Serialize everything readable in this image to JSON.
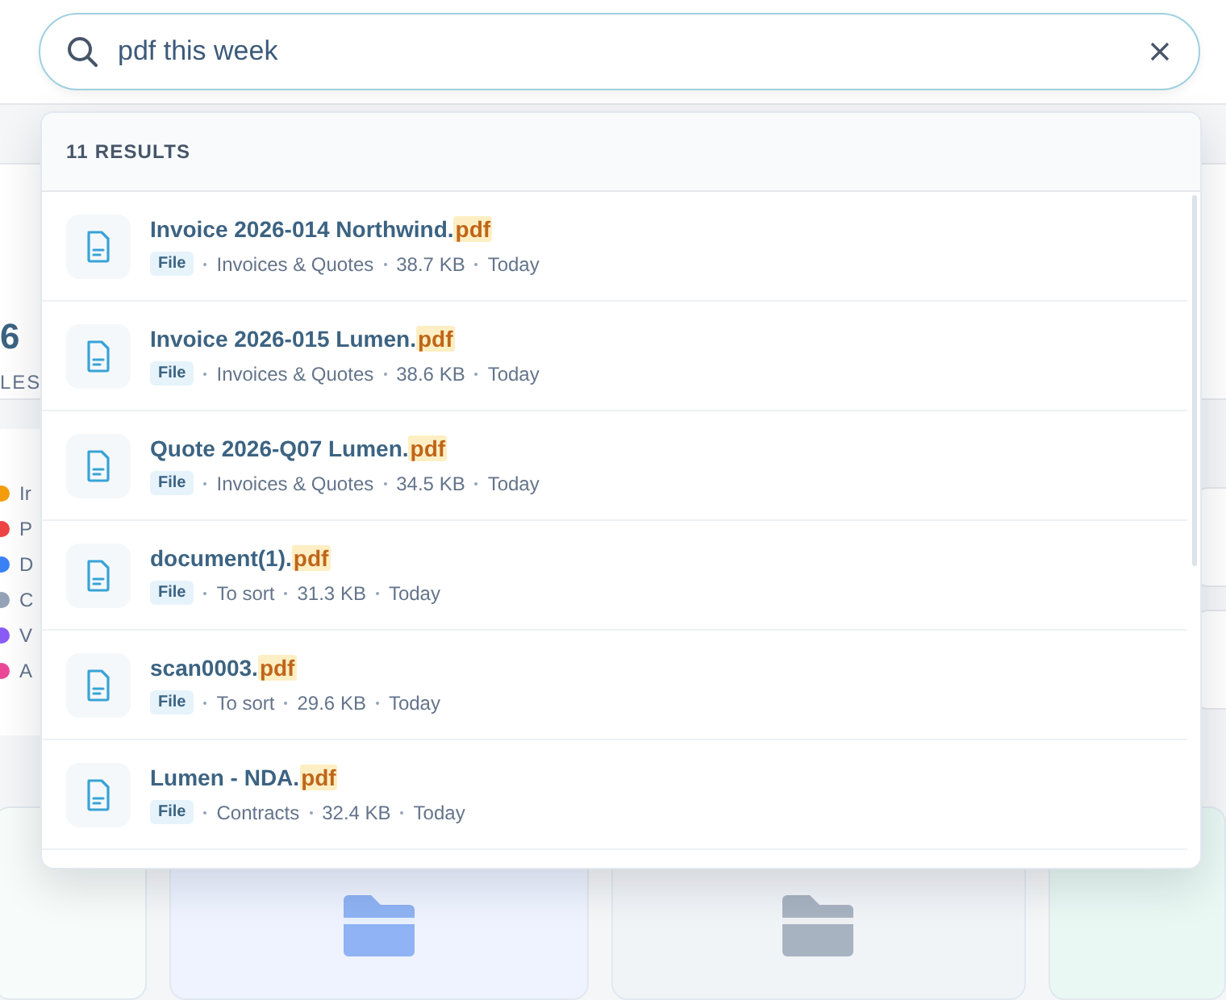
{
  "search": {
    "value": "pdf this week"
  },
  "background": {
    "stat_value": "6",
    "stat_label": "LES",
    "legend": [
      {
        "label": "Ir",
        "color": "#f59e0b"
      },
      {
        "label": "P",
        "color": "#ef4444"
      },
      {
        "label": "D",
        "color": "#3b82f6"
      },
      {
        "label": "C",
        "color": "#94a3b8"
      },
      {
        "label": "V",
        "color": "#8b5cf6"
      },
      {
        "label": "A",
        "color": "#ec4899"
      }
    ],
    "folders": [
      {
        "color": "#8fb3f4"
      },
      {
        "color": "#a8b3c2"
      }
    ]
  },
  "results_header": "11 RESULTS",
  "results": [
    {
      "title": "Invoice 2026-014 Northwind.",
      "highlight": "pdf",
      "tag": "File",
      "folder": "Invoices & Quotes",
      "size": "38.7 KB",
      "date": "Today"
    },
    {
      "title": "Invoice 2026-015 Lumen.",
      "highlight": "pdf",
      "tag": "File",
      "folder": "Invoices & Quotes",
      "size": "38.6 KB",
      "date": "Today"
    },
    {
      "title": "Quote 2026-Q07 Lumen.",
      "highlight": "pdf",
      "tag": "File",
      "folder": "Invoices & Quotes",
      "size": "34.5 KB",
      "date": "Today"
    },
    {
      "title": "document(1).",
      "highlight": "pdf",
      "tag": "File",
      "folder": "To sort",
      "size": "31.3 KB",
      "date": "Today"
    },
    {
      "title": "scan0003.",
      "highlight": "pdf",
      "tag": "File",
      "folder": "To sort",
      "size": "29.6 KB",
      "date": "Today"
    },
    {
      "title": "Lumen - NDA.",
      "highlight": "pdf",
      "tag": "File",
      "folder": "Contracts",
      "size": "32.4 KB",
      "date": "Today"
    }
  ]
}
